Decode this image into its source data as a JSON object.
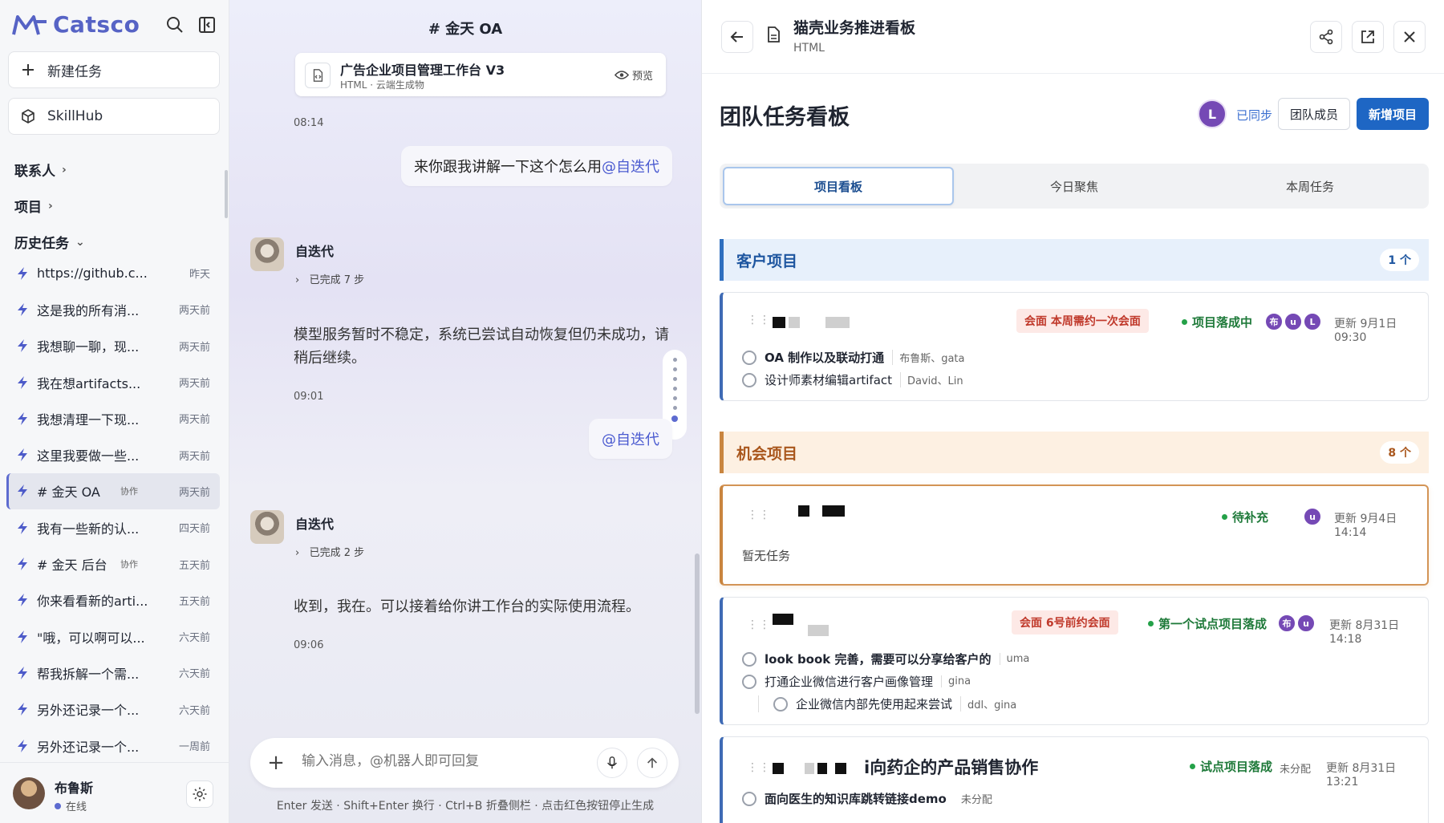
{
  "sidebar": {
    "logo_text": "Catsco",
    "new_task_label": "新建任务",
    "skillhub_label": "SkillHub",
    "sections": {
      "contacts": "联系人",
      "projects": "项目",
      "history": "历史任务"
    },
    "history_items": [
      {
        "title": "https://github.c...",
        "badge": "",
        "time": "昨天"
      },
      {
        "title": "这是我的所有消...",
        "badge": "",
        "time": "两天前"
      },
      {
        "title": "我想聊一聊，现...",
        "badge": "",
        "time": "两天前"
      },
      {
        "title": "我在想artifacts...",
        "badge": "",
        "time": "两天前"
      },
      {
        "title": "我想清理一下现...",
        "badge": "",
        "time": "两天前"
      },
      {
        "title": "这里我要做一些...",
        "badge": "",
        "time": "两天前"
      },
      {
        "title": "# 金天 OA",
        "badge": "协作",
        "time": "两天前"
      },
      {
        "title": "我有一些新的认...",
        "badge": "",
        "time": "四天前"
      },
      {
        "title": "# 金天 后台",
        "badge": "协作",
        "time": "五天前"
      },
      {
        "title": "你来看看新的arti...",
        "badge": "",
        "time": "五天前"
      },
      {
        "title": "\"哦，可以啊可以...",
        "badge": "",
        "time": "六天前"
      },
      {
        "title": "帮我拆解一个需...",
        "badge": "",
        "time": "六天前"
      },
      {
        "title": "另外还记录一个...",
        "badge": "",
        "time": "六天前"
      },
      {
        "title": "另外还记录一个...",
        "badge": "",
        "time": "一周前"
      }
    ],
    "user": {
      "name": "布鲁斯",
      "status": "在线"
    }
  },
  "chat": {
    "title": "# 金天 OA",
    "file_card": {
      "title": "广告企业项目管理工作台 V3",
      "subtitle": "HTML · 云端生成物",
      "preview": "预览"
    },
    "time1": "08:14",
    "user_msg1_text": "来你跟我讲解一下这个怎么用",
    "user_msg1_mention": "@自迭代",
    "bot_name": "自迭代",
    "bot_steps1": "已完成  7 步",
    "bot_msg1": "模型服务暂时不稳定，系统已尝试自动恢复但仍未成功，请稍后继续。",
    "time2": "09:01",
    "user_msg2_mention": "@自迭代",
    "bot_steps2": "已完成  2 步",
    "bot_msg2": "收到，我在。可以接着给你讲工作台的实际使用流程。",
    "time3": "09:06",
    "composer_placeholder": "输入消息，@机器人即可回复",
    "hint": "Enter 发送 · Shift+Enter 换行 · Ctrl+B 折叠侧栏 · 点击红色按钮停止生成"
  },
  "panel": {
    "title": "猫壳业务推进看板",
    "subtitle": "HTML",
    "board_title": "团队任务看板",
    "avatar_letter": "L",
    "synced": "已同步",
    "members_btn": "团队成员",
    "new_project_btn": "新增项目",
    "tabs": [
      "项目看板",
      "今日聚焦",
      "本周任务"
    ],
    "section_client": {
      "label": "客户项目",
      "count": "1 个"
    },
    "section_opportunity": {
      "label": "机会项目",
      "count": "8 个"
    },
    "card1": {
      "tag": "会面 本周需约一次会面",
      "status": "项目落成中",
      "avatars": [
        "布",
        "u",
        "L"
      ],
      "updated": "更新 9月1日 09:30",
      "tasks": [
        {
          "text": "OA 制作以及联动打通",
          "who": "布鲁斯、gata",
          "bold": true
        },
        {
          "text": "设计师素材编辑artifact",
          "who": "David、Lin",
          "bold": false
        }
      ]
    },
    "card2": {
      "status": "待补充",
      "avatars": [
        "u"
      ],
      "updated": "更新 9月4日 14:14",
      "empty": "暂无任务"
    },
    "card3": {
      "tag": "会面 6号前约会面",
      "status": "第一个试点项目落成",
      "avatars": [
        "布",
        "u"
      ],
      "updated": "更新 8月31日 14:18",
      "tasks": [
        {
          "text": "look book 完善，需要可以分享给客户的",
          "who": "uma",
          "bold": true
        },
        {
          "text": "打通企业微信进行客户画像管理",
          "who": "gina",
          "bold": false
        },
        {
          "text": "企业微信内部先使用起来尝试",
          "who": "ddl、gina",
          "bold": false
        }
      ]
    },
    "card4": {
      "title_tail": "i向药企的产品销售协作",
      "status": "试点项目落成",
      "unassigned": "未分配",
      "updated": "更新 8月31日 13:21",
      "tasks": [
        {
          "text": "面向医生的知识库跳转链接demo",
          "who": "未分配",
          "bold": true
        }
      ]
    }
  }
}
